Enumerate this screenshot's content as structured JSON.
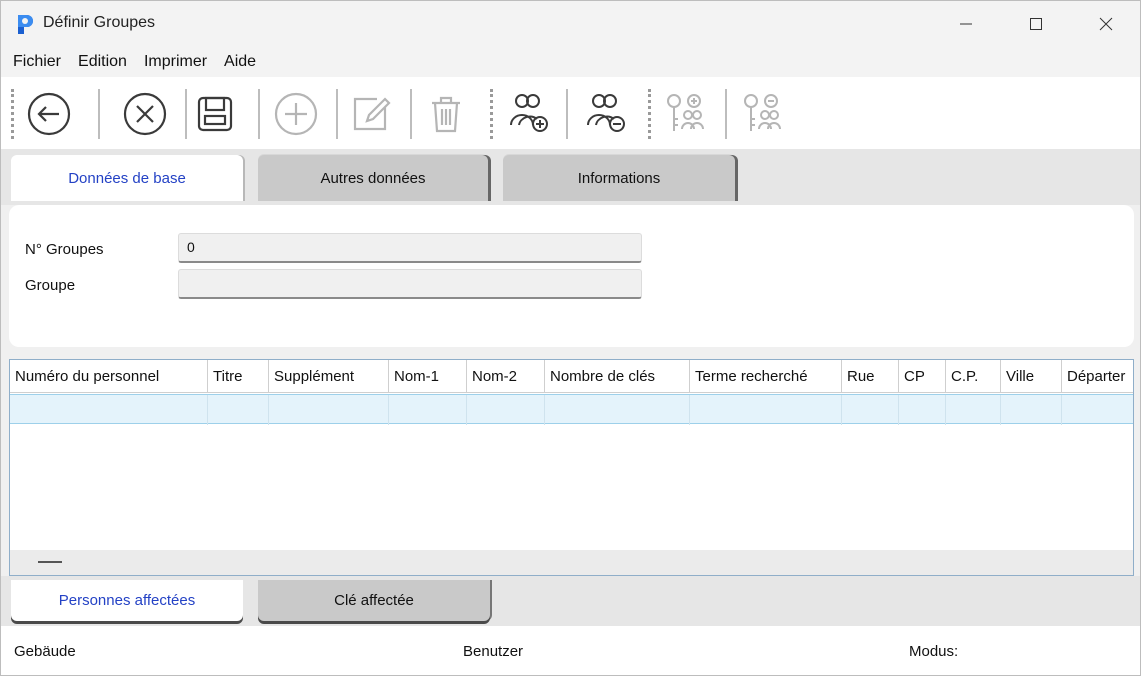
{
  "window": {
    "title": "Définir Groupes",
    "app_icon": "app-logo-icon",
    "controls": [
      "minimize-icon",
      "maximize-icon",
      "close-icon"
    ]
  },
  "menu": {
    "items": [
      "Fichier",
      "Edition",
      "Imprimer",
      "Aide"
    ]
  },
  "toolbar": {
    "buttons": [
      {
        "name": "back",
        "icon": "arrow-left-circle-icon",
        "enabled": true
      },
      {
        "name": "cancel",
        "icon": "x-circle-icon",
        "enabled": true
      },
      {
        "name": "save",
        "icon": "floppy-disk-icon",
        "enabled": true
      },
      {
        "name": "add",
        "icon": "plus-circle-icon",
        "enabled": false
      },
      {
        "name": "edit",
        "icon": "pencil-square-icon",
        "enabled": false
      },
      {
        "name": "delete",
        "icon": "trash-icon",
        "enabled": false
      },
      {
        "name": "add-persons",
        "icon": "users-plus-icon",
        "enabled": true
      },
      {
        "name": "remove-persons",
        "icon": "users-minus-icon",
        "enabled": true
      },
      {
        "name": "add-keys",
        "icon": "key-users-plus-icon",
        "enabled": false
      },
      {
        "name": "remove-keys",
        "icon": "key-users-minus-icon",
        "enabled": false
      }
    ]
  },
  "tabs": {
    "items": [
      "Données de base",
      "Autres données",
      "Informations"
    ],
    "active": "Données de base"
  },
  "form": {
    "group_no_label": "N° Groupes",
    "group_no_value": "0",
    "group_label": "Groupe",
    "group_value": ""
  },
  "grid": {
    "columns": [
      "Numéro du personnel",
      "Titre",
      "Supplément",
      "Nom-1",
      "Nom-2",
      "Nombre de clés",
      "Terme recherché",
      "Rue",
      "CP",
      "C.P.",
      "Ville",
      "Départer"
    ]
  },
  "bottom_tabs": {
    "items": [
      "Personnes affectées",
      "Clé affectée"
    ],
    "active": "Personnes affectées"
  },
  "status": {
    "building": "Gebäude",
    "user": "Benutzer",
    "mode": "Modus:"
  },
  "colors": {
    "active_tab_text": "#2442c5",
    "selected_row": "#e4f3fb",
    "toolbar_icon": "#3a3a3a",
    "toolbar_icon_disabled": "#b5b5b5"
  }
}
